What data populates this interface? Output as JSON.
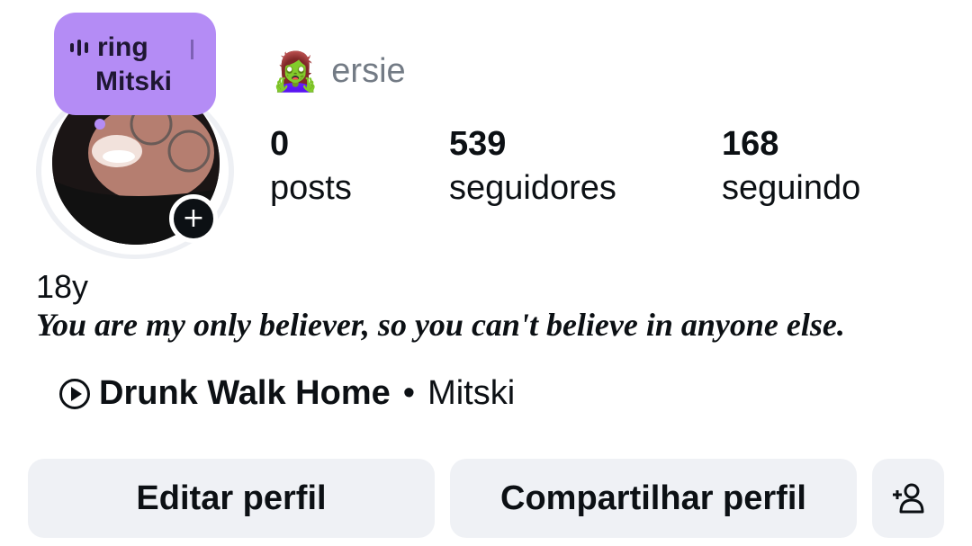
{
  "note": {
    "line1": "ring",
    "line2": "Mitski"
  },
  "profile": {
    "emoji": "🧟‍♀️",
    "username": "ersie"
  },
  "stats": {
    "posts": {
      "value": "0",
      "label": "posts"
    },
    "followers": {
      "value": "539",
      "label": "seguidores"
    },
    "following": {
      "value": "168",
      "label": "seguindo"
    }
  },
  "bio": {
    "age": "18y",
    "quote": "You are my only believer, so you can't believe in anyone else."
  },
  "music": {
    "song": "Drunk Walk Home",
    "separator": "•",
    "artist": "Mitski"
  },
  "buttons": {
    "edit": "Editar perfil",
    "share": "Compartilhar perfil",
    "add_person_icon": "add-person-icon"
  },
  "colors": {
    "note_bg": "#b48cf5",
    "button_bg": "#eff1f5",
    "username": "#737b85"
  }
}
